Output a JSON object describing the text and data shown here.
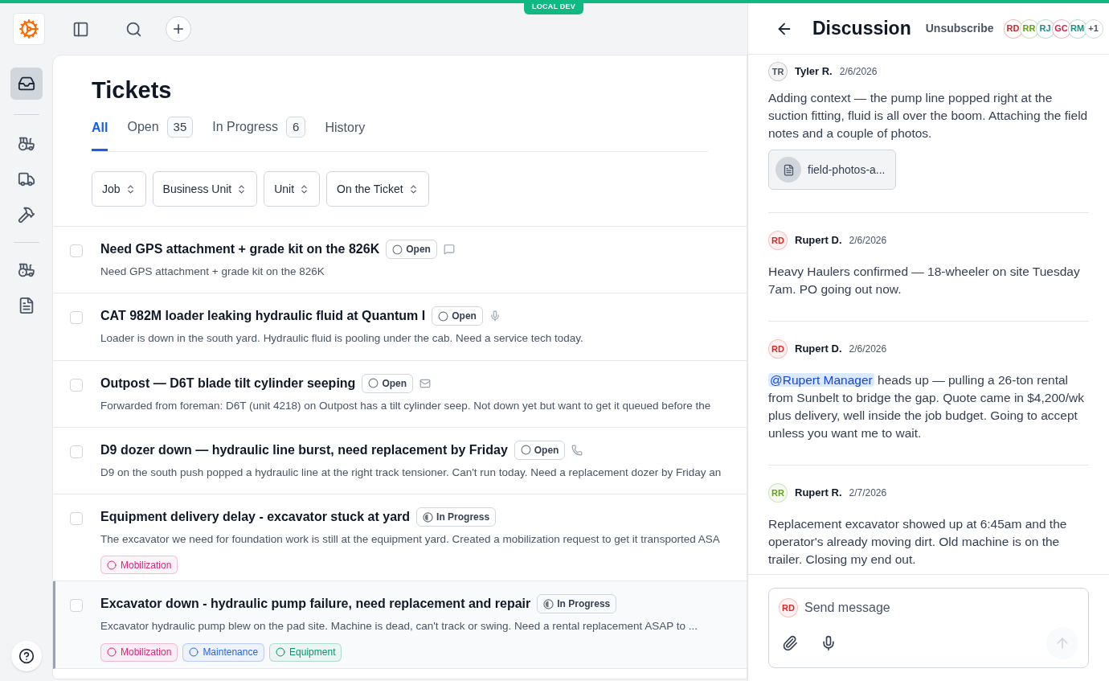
{
  "env_badge": "LOCAL DEV",
  "page_title": "Tickets",
  "tabs": [
    {
      "label": "All",
      "selected": true
    },
    {
      "label": "Open",
      "count": "35",
      "selected": false
    },
    {
      "label": "In Progress",
      "count": "6",
      "selected": false
    },
    {
      "label": "History",
      "selected": false
    }
  ],
  "filters": [
    "Job",
    "Business Unit",
    "Unit",
    "On the Ticket"
  ],
  "tickets": [
    {
      "title": "Need GPS attachment + grade kit on the 826K",
      "status": {
        "kind": "open",
        "label": "Open"
      },
      "kind": "chat",
      "description": "Need GPS attachment + grade kit on the 826K",
      "checked": false,
      "selected": false
    },
    {
      "title": "CAT 982M loader leaking hydraulic fluid at Quantum I",
      "status": {
        "kind": "open",
        "label": "Open"
      },
      "kind": "voice",
      "description": "Loader is down in the south yard. Hydraulic fluid is pooling under the cab. Need a service tech today.",
      "checked": false,
      "selected": false
    },
    {
      "title": "Outpost — D6T blade tilt cylinder seeping",
      "status": {
        "kind": "open",
        "label": "Open"
      },
      "kind": "email",
      "description": "Forwarded from foreman: D6T (unit 4218) on Outpost has a tilt cylinder seep. Not down yet but want to get it queued before the",
      "checked": false,
      "selected": false
    },
    {
      "title": "D9 dozer down — hydraulic line burst, need replacement by Friday",
      "status": {
        "kind": "open",
        "label": "Open"
      },
      "kind": "phone",
      "description": "D9 on the south push popped a hydraulic line at the right track tensioner. Can't run today. Need a replacement dozer by Friday an",
      "checked": false,
      "selected": false
    },
    {
      "title": "Equipment delivery delay - excavator stuck at yard",
      "status": {
        "kind": "in_progress",
        "label": "In Progress"
      },
      "description": "The excavator we need for foundation work is still at the equipment yard. Created a mobilization request to get it transported ASA",
      "tags": [
        {
          "label": "Mobilization",
          "color": "#db2777"
        }
      ],
      "checked": false,
      "selected": false
    },
    {
      "title": "Excavator down - hydraulic pump failure, need replacement and repair",
      "status": {
        "kind": "in_progress",
        "label": "In Progress"
      },
      "description": "Excavator hydraulic pump blew on the pad site. Machine is dead, can't track or swing. Need a rental replacement ASAP to ...",
      "tags": [
        {
          "label": "Mobilization",
          "color": "#db2777"
        },
        {
          "label": "Maintenance",
          "color": "#2563eb"
        },
        {
          "label": "Equipment",
          "color": "#059669"
        }
      ],
      "checked": false,
      "selected": true
    }
  ],
  "discussion": {
    "title": "Discussion",
    "unsubscribe": "Unsubscribe",
    "participants": [
      {
        "initials": "RD",
        "color": "#dc2626"
      },
      {
        "initials": "RR",
        "color": "#65a30d"
      },
      {
        "initials": "RJ",
        "color": "#0d9488"
      },
      {
        "initials": "GC",
        "color": "#e11d48"
      },
      {
        "initials": "RM",
        "color": "#0d9488"
      }
    ],
    "more": "+1",
    "messages": [
      {
        "initials": "TR",
        "color": "#4b5563",
        "author": "Tyler R.",
        "date": "2/6/2026",
        "body": "Adding context — the pump line popped right at the suction fitting, fluid is all over the boom. Attaching the field notes and a couple of photos.",
        "attachment": "field-photos-a..."
      },
      {
        "initials": "RD",
        "color": "#dc2626",
        "author": "Rupert D.",
        "date": "2/6/2026",
        "body": "Heavy Haulers confirmed — 18-wheeler on site Tuesday 7am. PO going out now."
      },
      {
        "initials": "RD",
        "color": "#dc2626",
        "author": "Rupert D.",
        "date": "2/6/2026",
        "mention": "@Rupert Manager",
        "body": "heads up — pulling a 26-ton rental from Sunbelt to bridge the gap. Quote came in $4,200/wk plus delivery, well inside the job budget. Going to accept unless you want me to wait."
      },
      {
        "initials": "RR",
        "color": "#65a30d",
        "author": "Rupert R.",
        "date": "2/7/2026",
        "body": "Replacement excavator showed up at 6:45am and the operator's already moving dirt. Old machine is on the trailer. Closing my end out."
      }
    ],
    "composer": {
      "initials": "RD",
      "color": "#dc2626",
      "placeholder": "Send message"
    }
  }
}
